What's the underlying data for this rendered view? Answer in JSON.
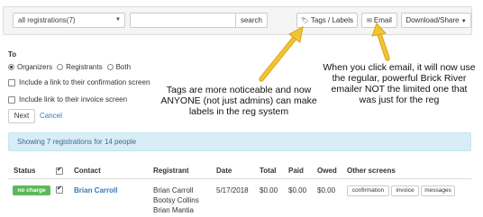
{
  "toolbar": {
    "filter_value": "all registrations(7)",
    "search_placeholder": "",
    "search_button": "search",
    "tags_button": "Tags / Labels",
    "email_button": "Email",
    "download_button": "Download/Share"
  },
  "form": {
    "to_label": "To",
    "radio_options": [
      "Organizers",
      "Registrants",
      "Both"
    ],
    "selected_radio": "Organizers",
    "check_confirmation": "Include a link to their confirmation screen",
    "check_invoice": "Include link to their invoice screen",
    "next_button": "Next",
    "cancel_link": "Cancel"
  },
  "annotations": {
    "tags": "Tags are more noticeable and now ANYONE (not just admins) can make labels in the reg system",
    "email": "When you click email, it will now use the regular, powerful Brick River emailer NOT the limited one that was just for the reg"
  },
  "info_text": "Showing 7 registrations for 14 people",
  "table": {
    "headers": {
      "status": "Status",
      "contact": "Contact",
      "registrant": "Registrant",
      "date": "Date",
      "total": "Total",
      "paid": "Paid",
      "owed": "Owed",
      "other": "Other screens"
    },
    "row": {
      "status": "no charge",
      "contact": "Brian Carroll",
      "registrants": [
        "Brian Carroll",
        "Bootsy Collins",
        "Brian Mantia"
      ],
      "date": "5/17/2018",
      "total": "$0.00",
      "paid": "$0.00",
      "owed": "$0.00",
      "buttons": [
        "confirmation",
        "invoice",
        "messages"
      ]
    }
  },
  "colors": {
    "link": "#337ab7",
    "badge": "#5cb85c",
    "info_bg": "#d9edf7",
    "arrow": "#f2c12e"
  }
}
